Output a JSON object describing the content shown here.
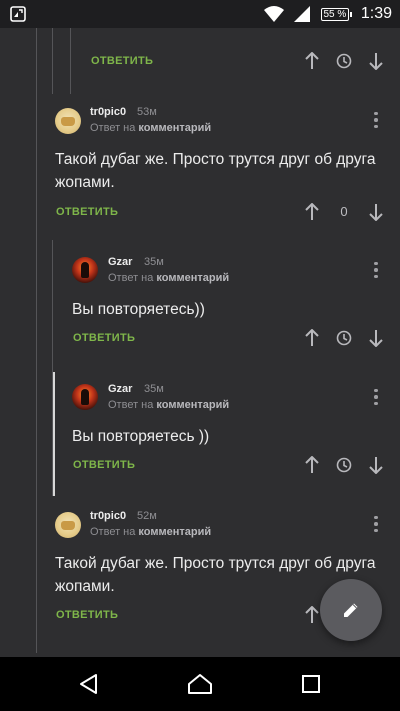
{
  "status_bar": {
    "battery_percent": "55 %",
    "time": "1:39",
    "icons": [
      "notification-icon",
      "wifi-icon",
      "signal-icon",
      "battery-icon"
    ]
  },
  "thread": {
    "top_partial": {
      "reply_label": "ОТВЕТИТЬ"
    },
    "comments": [
      {
        "author": "tr0pic0",
        "time": "53м",
        "reply_prefix": "Ответ на",
        "reply_link": "комментарий",
        "text": "Такой дубаг же. Просто трутся друг об друга жопами.",
        "reply_label": "ОТВЕТИТЬ",
        "score": "0"
      },
      {
        "author": "Gzar",
        "time": "35м",
        "reply_prefix": "Ответ на",
        "reply_link": "комментарий",
        "text": "Вы повторяетесь))",
        "reply_label": "ОТВЕТИТЬ"
      },
      {
        "author": "Gzar",
        "time": "35м",
        "reply_prefix": "Ответ на",
        "reply_link": "комментарий",
        "text": "Вы повторяетесь ))",
        "reply_label": "ОТВЕТИТЬ"
      },
      {
        "author": "tr0pic0",
        "time": "52м",
        "reply_prefix": "Ответ на",
        "reply_link": "комментарий",
        "text": "Такой дубаг же. Просто трутся друг об друга жопами.",
        "reply_label": "ОТВЕТИТЬ"
      }
    ]
  },
  "fab": {
    "icon": "pencil-icon"
  },
  "nav_bar": {
    "icons": [
      "back-icon",
      "home-icon",
      "recents-icon"
    ]
  },
  "colors": {
    "background": "#2e2e30",
    "reply_green": "#7fb64a",
    "fab": "#5b5b5f"
  }
}
